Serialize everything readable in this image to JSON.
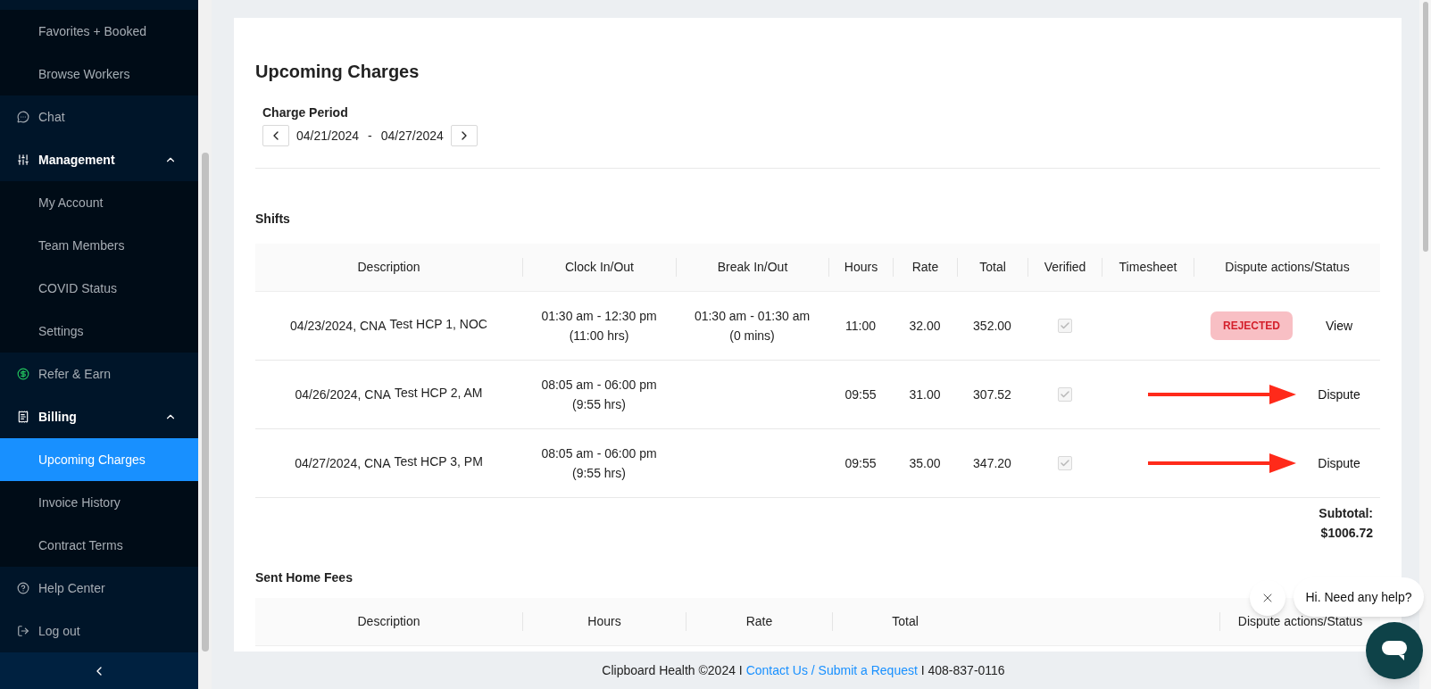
{
  "sidebar": {
    "items": [
      {
        "kind": "sub",
        "label": "Favorites + Booked",
        "selected": false
      },
      {
        "kind": "sub",
        "label": "Browse Workers",
        "selected": false
      },
      {
        "kind": "link",
        "label": "Chat",
        "selected": false
      },
      {
        "kind": "section",
        "label": "Management",
        "expanded": true,
        "selected": false
      },
      {
        "kind": "sub",
        "label": "My Account",
        "selected": false
      },
      {
        "kind": "sub",
        "label": "Team Members",
        "selected": false
      },
      {
        "kind": "sub",
        "label": "COVID Status",
        "selected": false
      },
      {
        "kind": "sub",
        "label": "Settings",
        "selected": false
      },
      {
        "kind": "link",
        "label": "Refer & Earn",
        "selected": false
      },
      {
        "kind": "section",
        "label": "Billing",
        "expanded": true,
        "selected": false
      },
      {
        "kind": "sub",
        "label": "Upcoming Charges",
        "selected": true
      },
      {
        "kind": "sub",
        "label": "Invoice History",
        "selected": false
      },
      {
        "kind": "sub",
        "label": "Contract Terms",
        "selected": false
      },
      {
        "kind": "link",
        "label": "Help Center",
        "selected": false
      },
      {
        "kind": "link",
        "label": "Log out",
        "selected": false
      }
    ]
  },
  "page": {
    "title": "Upcoming Charges",
    "charge_period": {
      "label": "Charge Period",
      "start": "04/21/2024",
      "separator": "-",
      "end": "04/27/2024"
    },
    "shifts": {
      "title": "Shifts",
      "columns": [
        "Description",
        "Clock In/Out",
        "Break In/Out",
        "Hours",
        "Rate",
        "Total",
        "Verified",
        "Timesheet",
        "Dispute actions/Status"
      ],
      "rows": [
        {
          "date_role": "04/23/2024, CNA",
          "worker": "Test HCP 1, NOC",
          "clock": [
            "01:30 am - 12:30 pm",
            "(11:00 hrs)"
          ],
          "break": [
            "01:30 am - 01:30 am",
            "(0 mins)"
          ],
          "hours": "11:00",
          "rate": "32.00",
          "total": "352.00",
          "verified": true,
          "status": {
            "kind": "rejected",
            "label": "REJECTED"
          },
          "action": "View",
          "arrow": false
        },
        {
          "date_role": "04/26/2024, CNA",
          "worker": "Test HCP 2, AM",
          "clock": [
            "08:05 am - 06:00 pm",
            "(9:55 hrs)"
          ],
          "hours": "09:55",
          "rate": "31.00",
          "total": "307.52",
          "verified": true,
          "action": "Dispute",
          "arrow": true
        },
        {
          "date_role": "04/27/2024, CNA",
          "worker": "Test HCP 3, PM",
          "clock": [
            "08:05 am - 06:00 pm",
            "(9:55 hrs)"
          ],
          "hours": "09:55",
          "rate": "35.00",
          "total": "347.20",
          "verified": true,
          "action": "Dispute",
          "arrow": true
        }
      ],
      "subtotal_label": "Subtotal:",
      "subtotal": "$1006.72"
    },
    "sent_home_fees": {
      "title": "Sent Home Fees",
      "columns": [
        "Description",
        "Hours",
        "Rate",
        "Total",
        "",
        "Dispute actions/Status"
      ]
    }
  },
  "footer": {
    "before": "Clipboard Health ©2024 I",
    "link": "Contact Us / Submit a Request",
    "after": "I 408-837-0116"
  },
  "chat": {
    "greeting": "Hi. Need any help?"
  }
}
